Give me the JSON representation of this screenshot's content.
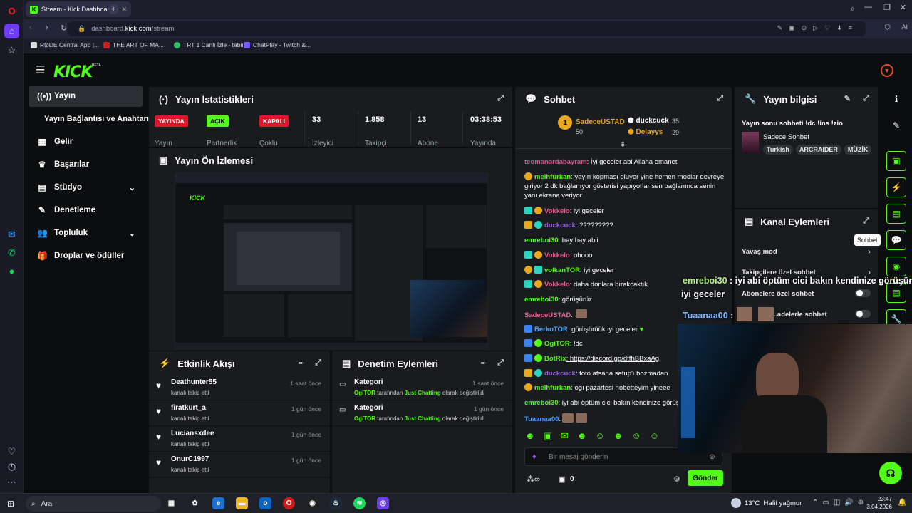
{
  "browser": {
    "tab_title": "Stream - Kick Dashboard",
    "url_prefix": "dashboard.",
    "url_domain": "kick.com",
    "url_path": "/stream",
    "bookmarks": [
      "RØDE Central App |...",
      "THE ART OF MA...",
      "TRT 1 Canlı İzle - tabii",
      "ChatPlay - Twitch &..."
    ]
  },
  "kick": {
    "logo": "KICK",
    "logo_beta": "BETA"
  },
  "nav": [
    {
      "label": "Yayın",
      "icon": "broadcast-icon"
    },
    {
      "label": "Yayın Bağlantısı ve Anahtarı",
      "icon": ""
    },
    {
      "label": "Gelir",
      "icon": "wallet-icon"
    },
    {
      "label": "Başarılar",
      "icon": "trophy-icon"
    },
    {
      "label": "Stüdyo",
      "icon": "studio-icon"
    },
    {
      "label": "Denetleme",
      "icon": "wrench-icon"
    },
    {
      "label": "Topluluk",
      "icon": "users-icon"
    },
    {
      "label": "Droplar ve ödüller",
      "icon": "gift-icon"
    }
  ],
  "stats": {
    "title": "Yayın İstatistikleri",
    "yayinda_badge": "YAYINDA",
    "yayin_label": "Yayın",
    "acik_badge": "AÇIK",
    "partnerlik_label": "Partnerlik",
    "kapali_badge": "KAPALI",
    "coklu_label": "Çoklu",
    "izleyici_value": "33",
    "izleyici_label": "İzleyici",
    "takipci_value": "1.858",
    "takipci_label": "Takipçi",
    "abone_value": "13",
    "abone_label": "Abone",
    "yayinda_value": "03:38:53",
    "yayinda_label": "Yayında",
    "colors": {
      "red": "#e0162b",
      "green": "#53fc18"
    }
  },
  "preview": {
    "title": "Yayın Ön İzlemesi"
  },
  "events": {
    "title": "Etkinlik Akışı",
    "items": [
      {
        "user": "Deathunter55",
        "desc": "kanalı takip etti",
        "time": "1 saat önce"
      },
      {
        "user": "firatkurt_a",
        "desc": "kanalı takip etti",
        "time": "1 gün önce"
      },
      {
        "user": "Luciansxdee",
        "desc": "kanalı takip etti",
        "time": "1 gün önce"
      },
      {
        "user": "OnurC1997",
        "desc": "kanalı takip etti",
        "time": "1 gün önce"
      }
    ]
  },
  "mod": {
    "title": "Denetim Eylemleri",
    "items": [
      {
        "title": "Kategori",
        "by": "OgiTOR",
        "mid": " tarafından ",
        "cat": "Just Chatting",
        "end": " olarak değiştirildi",
        "time": "1 saat önce"
      },
      {
        "title": "Kategori",
        "by": "OgiTOR",
        "mid": " tarafından ",
        "cat": "Just Chatting",
        "end": " olarak değiştirildi",
        "time": "1 gün önce"
      }
    ]
  },
  "chat": {
    "title": "Sohbet",
    "top1_user": "SadeceUSTAD",
    "top1_val": "50",
    "top2_user": "duckcuck",
    "top2_val": "35",
    "top3_user": "Delayys",
    "top3_val": "29",
    "messages": [
      {
        "user": "teomanardabayram",
        "text": ": İyi geceler abi Allaha emanet",
        "color": "#d05a8a"
      },
      {
        "user": "melhfurkan",
        "text": ": yayın kopması oluyor yine hemen modlar devreye",
        "color": "#53fc18"
      },
      {
        "user": "",
        "text": "giriyor 2 dk bağlanıyor gösterisi yapıyorlar sen bağlanınca senin",
        "color": "#fff"
      },
      {
        "user": "",
        "text": "yanı ekrana veriyor",
        "color": "#fff"
      },
      {
        "user": "Vokkelo",
        "text": ": iyi geceler",
        "color": "#e85d8a"
      },
      {
        "user": "duckcuck",
        "text": ": ?????????",
        "color": "#9b5de5"
      },
      {
        "user": "emreboi30",
        "text": ": bay bay abii",
        "color": "#53fc18"
      },
      {
        "user": "Vokkelo",
        "text": ": ohooo",
        "color": "#e85d8a"
      },
      {
        "user": "volkanTOR",
        "text": ": iyi geceler",
        "color": "#53fc18"
      },
      {
        "user": "Vokkelo",
        "text": ": daha donlara bırakcaktık",
        "color": "#e85d8a"
      },
      {
        "user": "emreboi30",
        "text": ": görüşürüz",
        "color": "#53fc18"
      },
      {
        "user": "SadeceUSTAD",
        "text": ":",
        "color": "#f06292"
      },
      {
        "user": "BerkoTOR",
        "text": ": görüşürüük iyi geceler",
        "color": "#4aa3ff"
      },
      {
        "user": "OgiTOR",
        "text": ": !dc",
        "color": "#53fc18"
      },
      {
        "user": "BotRix",
        "text": ": https://discord.gg/dtfhBBxaAg",
        "color": "#53fc18"
      },
      {
        "user": "duckcuck",
        "text": ": foto atsana setup'ı bozmadan",
        "color": "#9b5de5"
      },
      {
        "user": "melhfurkan",
        "text": ": ogı pazartesi nobetteyim yineee",
        "color": "#53fc18"
      },
      {
        "user": "emreboi30",
        "text": ": iyi abi öptüm cici bakın kendinize görüşü",
        "color": "#53fc18"
      },
      {
        "user": "Tuaanaa00",
        "text": ":",
        "color": "#4aa3ff"
      }
    ],
    "placeholder": "Bir mesaj gönderin",
    "points": "0",
    "send": "Gönder"
  },
  "info": {
    "title": "Yayın bilgisi",
    "stream_title": "Yayın sonu sohbeti !dc !ins !zio",
    "category": "Sadece Sohbet",
    "tags": [
      "Turkish",
      "ARCRAIDER",
      "MÜZİK"
    ]
  },
  "channel": {
    "title": "Kanal Eylemleri",
    "items": [
      "Yavaş mod",
      "Takipçilere özel sohbet",
      "Abonelere özel sohbet",
      "...adelerle sohbet"
    ]
  },
  "overlay": {
    "line1_user": "emreboi30",
    "line1_text": " : iyi abi öptüm cici bakın kendinize görüşürz",
    "line2_text": "iyi geceler",
    "line3_user": "Tuaanaa00",
    "line3_text": " :",
    "tooltip": "Sohbet"
  },
  "taskbar": {
    "search": "Ara",
    "weather": "13°C  Hafif yağmur",
    "time": "23:47",
    "date": "3.04.2026"
  }
}
